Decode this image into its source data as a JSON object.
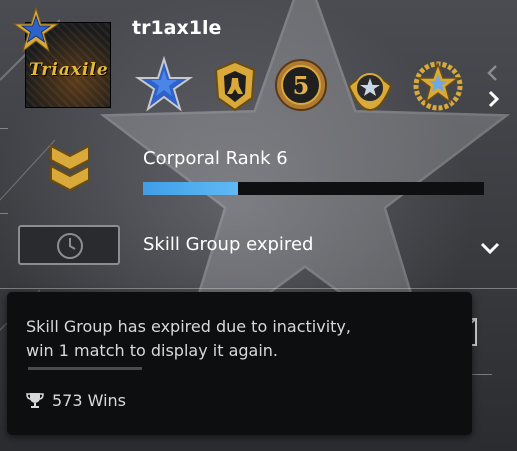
{
  "profile": {
    "username": "tr1ax1le",
    "avatar_text": "Triaxile"
  },
  "medals": [
    {
      "icon": "blue-star-medal-icon"
    },
    {
      "icon": "gold-soldier-medal-icon"
    },
    {
      "icon": "five-year-coin-icon",
      "text": "5"
    },
    {
      "icon": "silver-star-medal-icon"
    },
    {
      "icon": "gold-star-wreath-medal-icon"
    }
  ],
  "rank": {
    "label": "Corporal Rank 6",
    "progress": 0.28
  },
  "skill_group": {
    "label": "Skill Group expired"
  },
  "tooltip": {
    "line1": "Skill Group has expired due to inactivity,",
    "line2": "win 1 match to display it again.",
    "wins": "573 Wins"
  },
  "colors": {
    "accent_blue": "#4aa8ee",
    "gold": "#d9a93a",
    "panel": "#0d0e0f"
  }
}
